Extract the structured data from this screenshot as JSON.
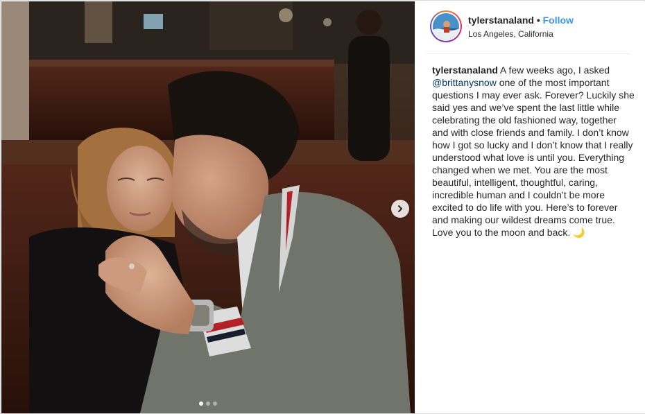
{
  "post": {
    "username": "tylerstanaland",
    "separator": "•",
    "follow_label": "Follow",
    "location": "Los Angeles, California",
    "caption": {
      "username": "tylerstanaland",
      "text_before_mention": " A few weeks ago, I asked ",
      "mention": "@brittanysnow",
      "text_after_mention": " one of the most important questions I may ever ask. Forever? Luckily she said yes and we’ve spent the last little while celebrating the old fashioned way, together and with close friends and family. I don’t know how I got so lucky and I don’t know that I really understood what love is until you. Everything changed when we met. You are the most beautiful, intelligent, thoughtful, caring, incredible human and I couldn’t be more excited to do life with you. Here’s to forever and making our wildest dreams come true. Love you to the moon and back. ",
      "emoji": "🌙"
    }
  },
  "media": {
    "icon": "chevron-right-icon",
    "carousel_total": 3,
    "carousel_active": 1
  },
  "colors": {
    "link": "#3897f0",
    "mention": "#003569",
    "text": "#262626",
    "border": "#dbdbdb"
  }
}
